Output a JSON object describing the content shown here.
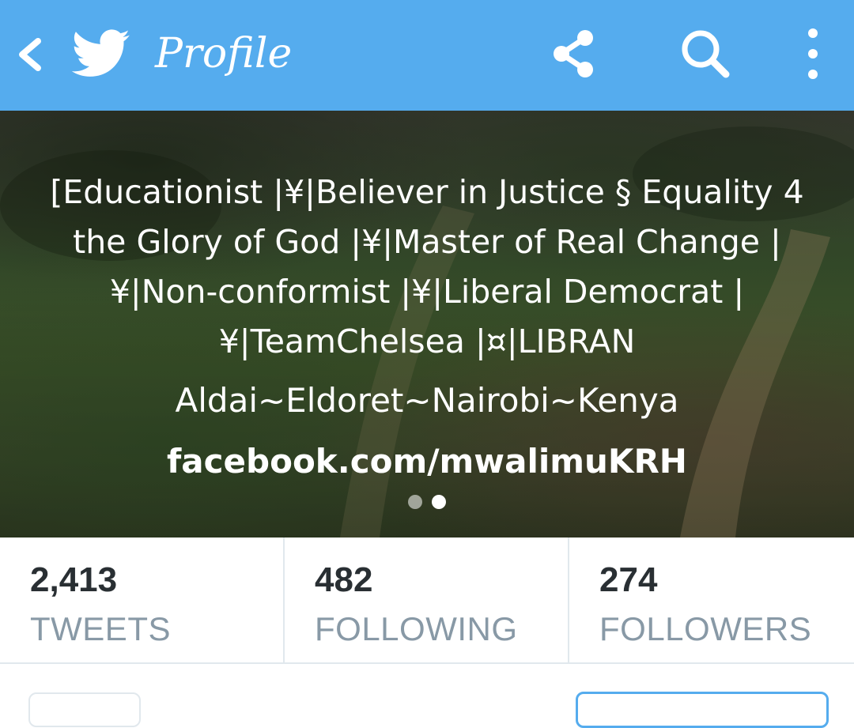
{
  "app_bar": {
    "title": "Profile",
    "background_color": "#55acee",
    "icons": {
      "back": "chevron-left-icon",
      "logo": "twitter-bird-icon",
      "share": "share-icon",
      "search": "search-icon",
      "more": "more-vertical-icon"
    }
  },
  "profile_header": {
    "bio": "[Educationist |¥|Believer in Justice § Equality 4 the Glory of God |¥|Master of Real Change |¥|Non-conformist |¥|Liberal Democrat |¥|TeamChelsea |¤|LIBRAN",
    "location": "Aldai~Eldoret~Nairobi~Kenya",
    "website": "facebook.com/mwalimuKRH",
    "pager": {
      "page_count": 2,
      "active_page": 2
    }
  },
  "stats": [
    {
      "value": "2,413",
      "label": "TWEETS"
    },
    {
      "value": "482",
      "label": "FOLLOWING"
    },
    {
      "value": "274",
      "label": "FOLLOWERS"
    }
  ],
  "colors": {
    "accent": "#55acee",
    "stat_value": "#292f33",
    "stat_label": "#8899a6",
    "divider": "#e1e8ed"
  }
}
